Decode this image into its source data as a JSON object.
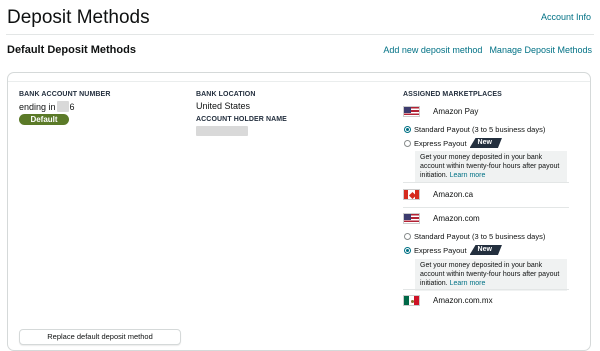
{
  "page": {
    "title": "Deposit Methods",
    "account_info_link": "Account Info"
  },
  "section": {
    "title": "Default Deposit Methods",
    "add_link": "Add new deposit method",
    "manage_link": "Manage Deposit Methods"
  },
  "bank": {
    "account_number_label": "BANK ACCOUNT NUMBER",
    "ending_prefix": "ending in",
    "ending_suffix": "6",
    "default_badge": "Default",
    "location_label": "BANK LOCATION",
    "location_value": "United States",
    "holder_label": "ACCOUNT HOLDER NAME"
  },
  "marketplaces": {
    "label": "ASSIGNED MARKETPLACES",
    "items": [
      {
        "name": "Amazon Pay",
        "flag": "us-flag",
        "options": [
          {
            "label": "Standard Payout (3 to 5 business days)",
            "checked": true
          },
          {
            "label": "Express Payout",
            "checked": false,
            "badge": "New"
          }
        ],
        "info": "Get your money deposited in your bank account within twenty-four hours after payout initiation.",
        "learn_more": "Learn more"
      },
      {
        "name": "Amazon.ca",
        "flag": "ca-flag"
      },
      {
        "name": "Amazon.com",
        "flag": "us-flag",
        "options": [
          {
            "label": "Standard Payout (3 to 5 business days)",
            "checked": false
          },
          {
            "label": "Express Payout",
            "checked": true,
            "badge": "New"
          }
        ],
        "info": "Get your money deposited in your bank account within twenty-four hours after payout initiation.",
        "learn_more": "Learn more"
      },
      {
        "name": "Amazon.com.mx",
        "flag": "mx-flag"
      }
    ]
  },
  "actions": {
    "replace_button": "Replace default deposit method"
  },
  "colors": {
    "link": "#007185",
    "default_badge": "#5b7a28",
    "new_badge": "#232f3e"
  }
}
